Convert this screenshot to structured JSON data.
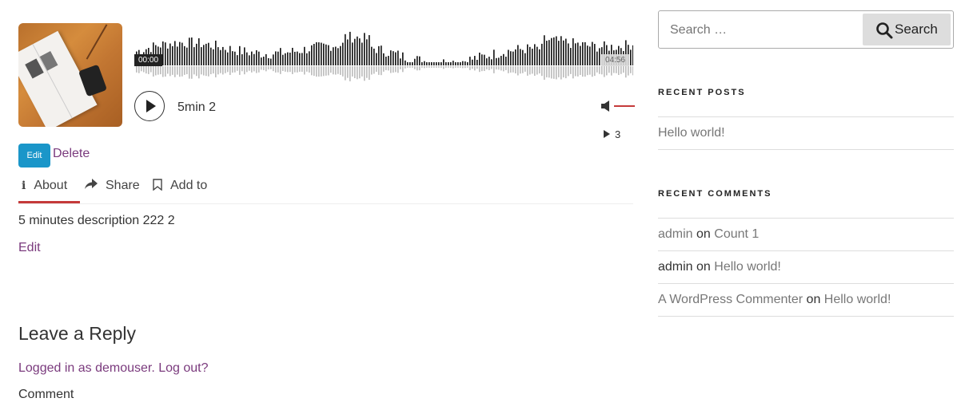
{
  "player": {
    "time_current": "00:00",
    "time_total": "04:56",
    "track_title": "5min 2",
    "play_count": "3",
    "accent_color": "#c53a3a"
  },
  "actions": {
    "edit_button": "Edit",
    "delete_link": "Delete"
  },
  "tabs": {
    "about": "About",
    "share": "Share",
    "add_to": "Add to"
  },
  "content": {
    "description": "5 minutes description 222 2",
    "edit_link": "Edit"
  },
  "reply": {
    "title": "Leave a Reply",
    "logged_in": "Logged in as demouser. Log out?",
    "comment_label": "Comment"
  },
  "sidebar": {
    "search": {
      "placeholder": "Search …",
      "button": "Search"
    },
    "recent_posts": {
      "title": "RECENT POSTS",
      "items": [
        "Hello world!"
      ]
    },
    "recent_comments": {
      "title": "RECENT COMMENTS",
      "items": [
        {
          "author": "admin",
          "on": "on",
          "post": "Count 1"
        },
        {
          "author": "admin",
          "on": "on",
          "post": "Hello world!"
        },
        {
          "author": "A WordPress Commenter",
          "on": "on",
          "post": "Hello world!"
        }
      ]
    }
  }
}
